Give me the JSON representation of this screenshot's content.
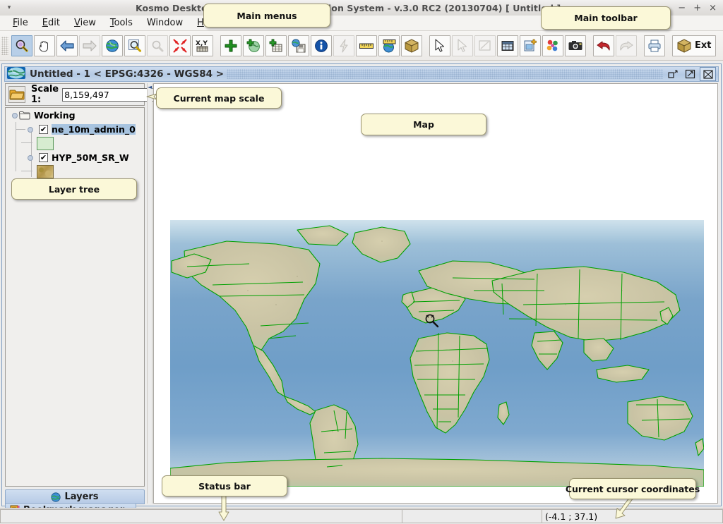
{
  "window": {
    "title": "Kosmo Desktop - Geographic Information System - v.3.0 RC2 (20130704)  [ Untitled ]",
    "menu_icon": "window-menu-icon",
    "minimize": "−",
    "maximize": "+",
    "close": "×"
  },
  "menubar": {
    "items": [
      {
        "label": "File",
        "mnemonic": "F"
      },
      {
        "label": "Edit",
        "mnemonic": "E"
      },
      {
        "label": "View",
        "mnemonic": "V"
      },
      {
        "label": "Tools",
        "mnemonic": "T"
      },
      {
        "label": "Window",
        "mnemonic": "W"
      },
      {
        "label": "Help",
        "mnemonic": "H"
      }
    ]
  },
  "toolbar": {
    "buttons": [
      {
        "name": "zoom-in-tool-icon",
        "state": "selected"
      },
      {
        "name": "pan-hand-tool-icon",
        "state": "normal"
      },
      {
        "name": "back-arrow-icon",
        "state": "normal"
      },
      {
        "name": "forward-arrow-icon",
        "state": "disabled"
      },
      {
        "name": "zoom-full-extent-globe-icon",
        "state": "normal"
      },
      {
        "name": "zoom-to-selection-icon",
        "state": "normal"
      },
      {
        "name": "zoom-previous-icon",
        "state": "disabled"
      },
      {
        "name": "zoom-to-layer-icon",
        "state": "normal"
      },
      {
        "name": "goto-xy-coordinate-icon",
        "state": "normal"
      },
      {
        "name": "add-layer-icon",
        "state": "normal"
      },
      {
        "name": "add-wms-layer-icon",
        "state": "normal"
      },
      {
        "name": "add-table-layer-icon",
        "state": "normal"
      },
      {
        "name": "save-layer-icon",
        "state": "normal"
      },
      {
        "name": "layer-info-icon",
        "state": "normal"
      },
      {
        "name": "flash-feature-icon",
        "state": "disabled"
      },
      {
        "name": "measure-ruler-icon",
        "state": "normal"
      },
      {
        "name": "measure-geodesic-icon",
        "state": "normal"
      },
      {
        "name": "extensions-box-icon",
        "state": "normal"
      },
      {
        "name": "select-pointer-icon",
        "state": "normal"
      },
      {
        "name": "select-feature-icon",
        "state": "disabled"
      },
      {
        "name": "edit-geometry-icon",
        "state": "disabled"
      },
      {
        "name": "attribute-table-icon",
        "state": "normal"
      },
      {
        "name": "new-map-composition-icon",
        "state": "normal"
      },
      {
        "name": "symbology-icon",
        "state": "normal"
      },
      {
        "name": "screenshot-camera-icon",
        "state": "normal"
      },
      {
        "name": "undo-icon",
        "state": "normal"
      },
      {
        "name": "redo-icon",
        "state": "disabled"
      },
      {
        "name": "print-icon",
        "state": "normal"
      },
      {
        "name": "extensions-ext-button",
        "state": "normal",
        "label": "Ext"
      }
    ]
  },
  "document": {
    "title": "Untitled - 1 < EPSG:4326 - WGS84 >",
    "icon": "globe-icon",
    "restore_label": "restore",
    "maximize_label": "maximize",
    "close_label": "×"
  },
  "scale": {
    "folder_icon": "open-folder-icon",
    "label": "Scale 1:",
    "value": "8,159,497"
  },
  "layer_tree": {
    "root": {
      "label": "Working",
      "icon": "folder-icon"
    },
    "layers": [
      {
        "label": "ne_10m_admin_0",
        "checked": true,
        "selected": true,
        "symbol": "polygon-swatch"
      },
      {
        "label": "HYP_50M_SR_W",
        "checked": true,
        "selected": false,
        "symbol": "raster-swatch"
      }
    ],
    "checkmark": "✔"
  },
  "panel_tabs": [
    {
      "label": "Layers",
      "icon": "globe-icon",
      "active": true
    },
    {
      "label": "Bookmark manager",
      "icon": "bookmark-icon",
      "active": false
    }
  ],
  "map": {
    "cursor": "magnifier-cursor",
    "ocean_color": "#7fa9cf",
    "land_color": "#cdc7a8",
    "border_color": "#00a000"
  },
  "statusbar": {
    "message": "",
    "secondary": "",
    "coordinates": "(-4.1 ; 37.1)"
  },
  "callouts": [
    {
      "id": "main-menus",
      "text": "Main menus"
    },
    {
      "id": "main-toolbar",
      "text": "Main toolbar"
    },
    {
      "id": "current-map-scale",
      "text": "Current map scale"
    },
    {
      "id": "map",
      "text": "Map"
    },
    {
      "id": "layer-tree",
      "text": "Layer tree"
    },
    {
      "id": "status-bar",
      "text": "Status bar"
    },
    {
      "id": "cursor-coords",
      "text": "Current cursor coordinates"
    }
  ]
}
